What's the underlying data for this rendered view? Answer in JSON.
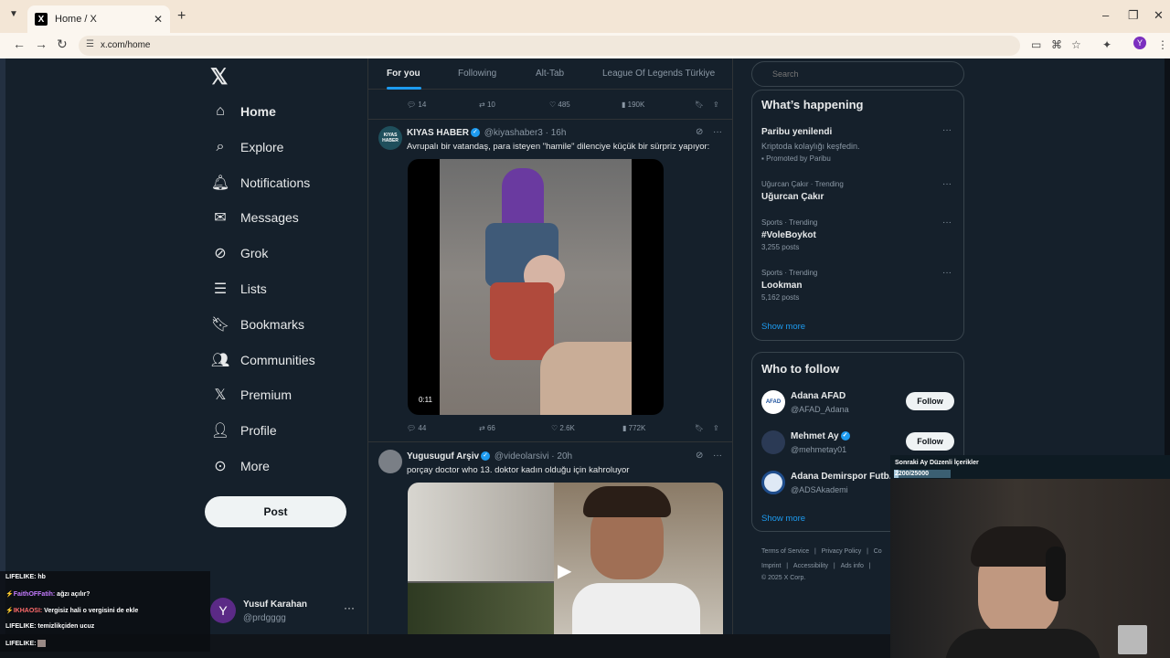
{
  "browser": {
    "tab_title": "Home / X",
    "url": "x.com/home",
    "profile_initial": "Y"
  },
  "nav": {
    "items": [
      {
        "label": "Home",
        "icon": "home-icon"
      },
      {
        "label": "Explore",
        "icon": "search-icon"
      },
      {
        "label": "Notifications",
        "icon": "bell-icon"
      },
      {
        "label": "Messages",
        "icon": "mail-icon"
      },
      {
        "label": "Grok",
        "icon": "grok-icon"
      },
      {
        "label": "Lists",
        "icon": "list-icon"
      },
      {
        "label": "Bookmarks",
        "icon": "bookmark-icon"
      },
      {
        "label": "Communities",
        "icon": "people-icon"
      },
      {
        "label": "Premium",
        "icon": "x-icon"
      },
      {
        "label": "Profile",
        "icon": "person-icon"
      },
      {
        "label": "More",
        "icon": "more-circle-icon"
      }
    ],
    "post_label": "Post",
    "account": {
      "initial": "Y",
      "name": "Yusuf Karahan",
      "handle": "@prdgggg"
    }
  },
  "feed": {
    "tabs": [
      "For you",
      "Following",
      "Alt-Tab",
      "League Of Legends Türkiye"
    ],
    "top_actions": {
      "replies": "14",
      "reposts": "10",
      "likes": "485",
      "views": "190K"
    },
    "tweets": [
      {
        "name": "KIYAS HABER",
        "handle": "@kiyashaber3",
        "time": "16h",
        "avatar_text": "KIYAS HABER",
        "text": "Avrupalı bir vatandaş, para isteyen \"hamile\" dilenciye küçük bir sürpriz yapıyor:",
        "video_time": "0:11",
        "actions": {
          "replies": "44",
          "reposts": "66",
          "likes": "2.6K",
          "views": "772K"
        }
      },
      {
        "name": "Yugusuguf Arşiv",
        "handle": "@videolarsivi",
        "time": "20h",
        "text": "porçay doctor who 13. doktor kadın olduğu için kahroluyor"
      }
    ]
  },
  "sidebar": {
    "search_placeholder": "Search",
    "happening_title": "What’s happening",
    "trends": [
      {
        "meta": "",
        "topic": "Paribu yenilendi",
        "sub": "Kriptoda kolaylığı keşfedin.",
        "extra": "Promoted by Paribu"
      },
      {
        "meta": "Uğurcan Çakır · Trending",
        "topic": "Uğurcan Çakır",
        "sub": "",
        "extra": ""
      },
      {
        "meta": "Sports · Trending",
        "topic": "#VoleBoykot",
        "sub": "3,255 posts",
        "extra": ""
      },
      {
        "meta": "Sports · Trending",
        "topic": "Lookman",
        "sub": "5,162 posts",
        "extra": ""
      }
    ],
    "show_more": "Show more",
    "who_title": "Who to follow",
    "who": [
      {
        "name": "Adana AFAD",
        "handle": "@AFAD_Adana",
        "avatar_text": "AFAD"
      },
      {
        "name": "Mehmet Ay",
        "handle": "@mehmetay01",
        "avatar_text": ""
      },
      {
        "name": "Adana Demirspor Futb.",
        "handle": "@ADSAkademi",
        "avatar_text": ""
      }
    ],
    "follow_label": "Follow",
    "footer": [
      "Terms of Service",
      "|",
      "Privacy Policy",
      "|",
      "Co",
      "Imprint",
      "|",
      "Accessibility",
      "|",
      "Ads info",
      "|",
      "© 2025 X Corp."
    ]
  },
  "chat": [
    {
      "user": "LIFELIKE:",
      "msg": "hb",
      "color": "#ffffff"
    },
    {
      "user": "FaithOFFatih:",
      "msg": "ağzı açılır?",
      "color": "#c57bff"
    },
    {
      "user": "IKHAOSI:",
      "msg": "Vergisiz hali o vergisini de ekle",
      "color": "#ff6b6b"
    },
    {
      "user": "LIFELIKE:",
      "msg": "temizlikçiden ucuz",
      "color": "#ffffff"
    },
    {
      "user": "LIFELIKE:",
      "msg": "",
      "color": "#ffffff"
    }
  ],
  "stream": {
    "title": "Sonraki Ay Düzenli İçerikler",
    "count": "2200/25000",
    "progress": 0.088
  },
  "colors": {
    "accent": "#1d9bf0",
    "bg": "#15202b"
  }
}
